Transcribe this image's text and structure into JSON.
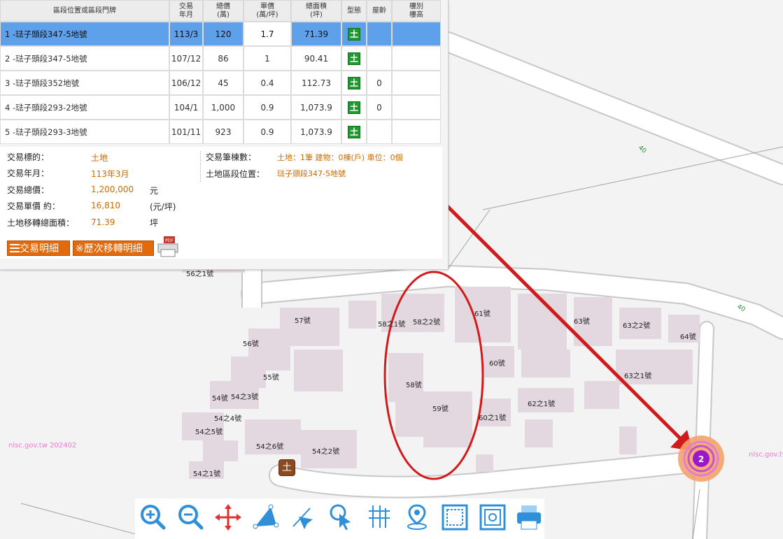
{
  "table": {
    "headers": [
      "區段位置或區段門牌",
      "交易\n年月",
      "總價\n(萬)",
      "單價\n(萬/坪)",
      "總面積\n(坪)",
      "型態",
      "屋齡",
      "樓別\n樓高"
    ],
    "rows": [
      {
        "addr": "1 -琺子頭段347-5地號",
        "ym": "113/3",
        "total": "120",
        "unit": "1.7",
        "area": "71.39",
        "type": "土",
        "age": "",
        "floor": ""
      },
      {
        "addr": "2 -琺子頭段347-5地號",
        "ym": "107/12",
        "total": "86",
        "unit": "1",
        "area": "90.41",
        "type": "土",
        "age": "",
        "floor": ""
      },
      {
        "addr": "3 -琺子頭段352地號",
        "ym": "106/12",
        "total": "45",
        "unit": "0.4",
        "area": "112.73",
        "type": "土",
        "age": "0",
        "floor": ""
      },
      {
        "addr": "4 -琺子頭段293-2地號",
        "ym": "104/1",
        "total": "1,000",
        "unit": "0.9",
        "area": "1,073.9",
        "type": "土",
        "age": "0",
        "floor": ""
      },
      {
        "addr": "5 -琺子頭段293-3地號",
        "ym": "101/11",
        "total": "923",
        "unit": "0.9",
        "area": "1,073.9",
        "type": "土",
        "age": "",
        "floor": ""
      }
    ]
  },
  "details": {
    "target_label": "交易標的：",
    "target": "土地",
    "date_label": "交易年月：",
    "date": "113年3月",
    "total_label": "交易總價：",
    "total": "1,200,000",
    "total_unit": "元",
    "unit_label": "交易單價 約：",
    "unit_price": "16,810",
    "unit_unit": "(元/坪)",
    "area_label": "土地移轉總面積：",
    "area": "71.39",
    "area_unit": "坪",
    "count_label": "交易筆棟數：",
    "count": "土地：1筆 建物：0棟(戶) 車位：0個",
    "loc_label": "土地區段位置：",
    "loc": "琺子頭段347-5地號",
    "btn_detail": "交易明細",
    "btn_history": "※歷次移轉明細",
    "pdf_badge": "PDF"
  },
  "map": {
    "labels": [
      {
        "t": "56之1號"
      },
      {
        "t": "57號"
      },
      {
        "t": "58之1號"
      },
      {
        "t": "58之2號"
      },
      {
        "t": "61號"
      },
      {
        "t": "63號"
      },
      {
        "t": "63之2號"
      },
      {
        "t": "64號"
      },
      {
        "t": "56號"
      },
      {
        "t": "55號"
      },
      {
        "t": "60號"
      },
      {
        "t": "63之1號"
      },
      {
        "t": "58號"
      },
      {
        "t": "54號"
      },
      {
        "t": "54之3號"
      },
      {
        "t": "59號"
      },
      {
        "t": "62之1號"
      },
      {
        "t": "54之4號"
      },
      {
        "t": "60之1號"
      },
      {
        "t": "54之5號"
      },
      {
        "t": "54之6號"
      },
      {
        "t": "54之2號"
      },
      {
        "t": "54之1號"
      }
    ],
    "road_labels": [
      "40",
      "40"
    ],
    "watermark_left": "nlsc.gov.tw 202402",
    "watermark_right": "nlsc.gov.tw",
    "land_marker": "土",
    "cluster_count": "2"
  },
  "toolbar": [
    "zoom-in",
    "zoom-out",
    "pan",
    "measure-area",
    "select",
    "identify",
    "grid",
    "locate",
    "frame-a",
    "frame-b",
    "print"
  ]
}
